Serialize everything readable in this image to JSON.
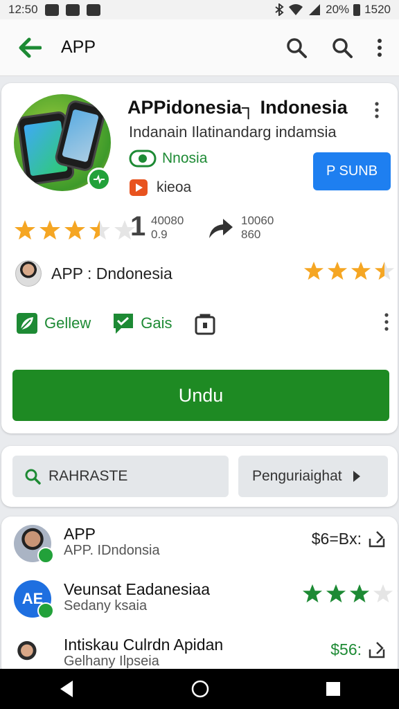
{
  "status_bar": {
    "time": "12:50",
    "battery": "20%",
    "clock_right": "1520"
  },
  "app_bar": {
    "title": "APP"
  },
  "app": {
    "title": "APPidonesia┐ Indonesia",
    "subtitle": "Indanain Ilatinandarg indamsia",
    "developer": "Nnosia",
    "category": "kieoa",
    "install_label": "P SUNB",
    "rating": 3.5,
    "stat_big": "1",
    "stat_a1": "40080",
    "stat_a2": "0.9",
    "stat_b1": "10060",
    "stat_b2": "860"
  },
  "dev_line": {
    "label": "APP : Dndonesia",
    "rating": 3.5
  },
  "actions": {
    "a1": "Gellew",
    "a2": "Gais"
  },
  "main_button": {
    "label": "Undu"
  },
  "filters": {
    "pill1": "RAHRASTE",
    "pill2": "Penguriaighat"
  },
  "list": [
    {
      "title": "APP",
      "subtitle": "APP. IDndonsia",
      "right_text": "$6=Bx:",
      "rating": null
    },
    {
      "title": "Veunsat Eadanesiaa",
      "subtitle": "Sedany ksaia",
      "right_text": "",
      "rating": 3
    },
    {
      "title": "Intiskau Culrdn Apidan",
      "subtitle": "Gelhany Ilpseia",
      "right_text": "$56:",
      "rating": null
    }
  ],
  "colors": {
    "green": "#1e8a23",
    "blue": "#1e7ff0",
    "star": "#f5a623",
    "star_green": "#1d8a34"
  }
}
